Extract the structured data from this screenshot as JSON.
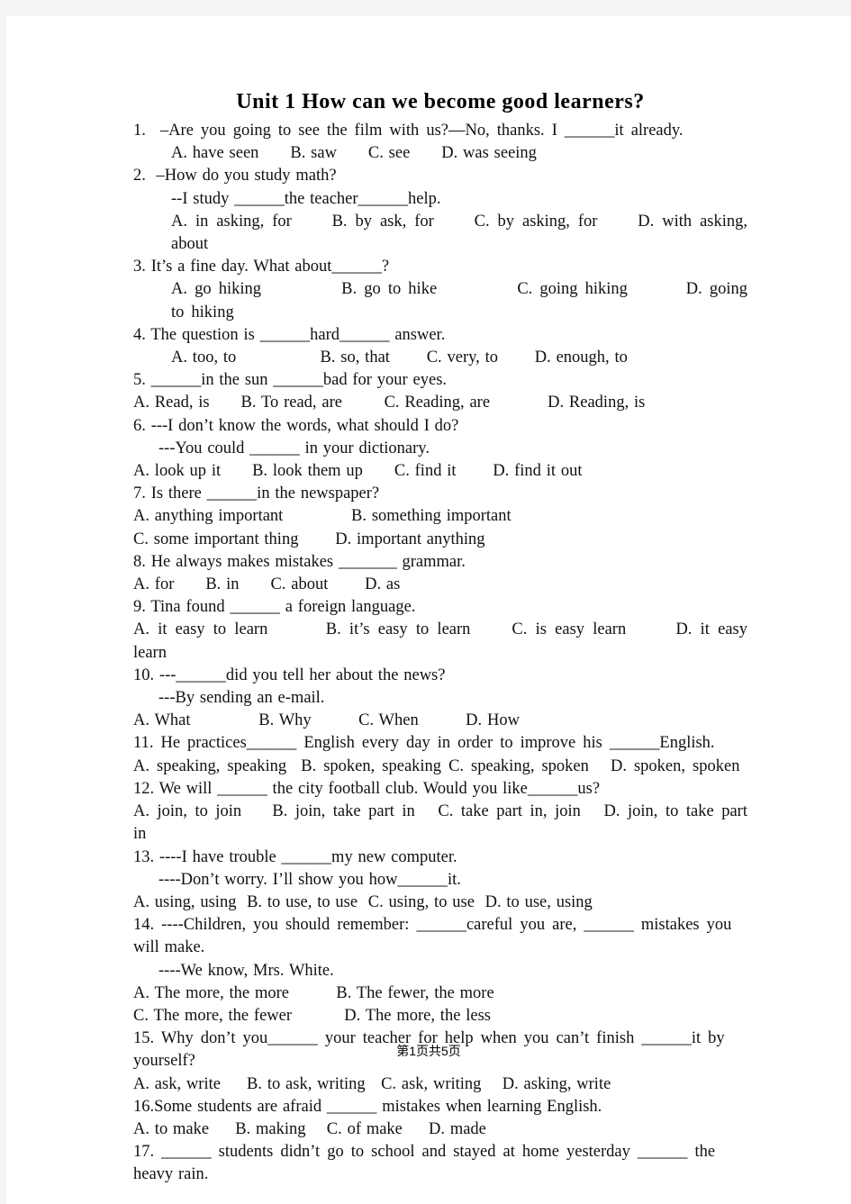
{
  "document": {
    "title": "Unit 1 How can we become good learners?",
    "footer": "第1页共5页",
    "page_background": "#ffffff",
    "canvas_background": "#f4f4f4",
    "text_color": "#111111"
  },
  "lines": [
    {
      "text": "1.  –Are you going to see the film with us?—No, thanks. I ______it already.",
      "indent": 0,
      "wide": true
    },
    {
      "text": "A. have seen      B. saw      C. see      D. was seeing",
      "indent": 3,
      "wide": false
    },
    {
      "text": "2.  –How do you study math?",
      "indent": 0,
      "wide": false
    },
    {
      "text": "--I study ______the teacher______help.",
      "indent": 3,
      "wide": false
    },
    {
      "text": "A. in asking, for     B. by ask, for     C. by asking, for     D. with asking, about",
      "indent": 3,
      "wide": true
    },
    {
      "text": "3. It’s a fine day. What about______?",
      "indent": 0,
      "wide": false
    },
    {
      "text": "A. go hiking           B. go to hike           C. going hiking        D. going to hiking",
      "indent": 3,
      "wide": true
    },
    {
      "text": "4. The question is ______hard______ answer.",
      "indent": 0,
      "wide": false
    },
    {
      "text": "A. too, to                B. so, that       C. very, to       D. enough, to",
      "indent": 3,
      "wide": false
    },
    {
      "text": "5. ______in the sun ______bad for your eyes.",
      "indent": 0,
      "wide": false
    },
    {
      "text": "A. Read, is      B. To read, are        C. Reading, are           D. Reading, is",
      "indent": 0,
      "wide": false
    },
    {
      "text": "6. ---I don’t know the words, what should I do?",
      "indent": 0,
      "wide": false
    },
    {
      "text": "---You could ______ in your dictionary.",
      "indent": 2,
      "wide": false
    },
    {
      "text": "A. look up it      B. look them up      C. find it       D. find it out",
      "indent": 0,
      "wide": false
    },
    {
      "text": "7. Is there ______in the newspaper?",
      "indent": 0,
      "wide": false
    },
    {
      "text": "A. anything important             B. something important",
      "indent": 0,
      "wide": false
    },
    {
      "text": "C. some important thing       D. important anything",
      "indent": 0,
      "wide": false
    },
    {
      "text": "8. He always makes mistakes _______ grammar.",
      "indent": 0,
      "wide": false
    },
    {
      "text": "A. for      B. in      C. about       D. as",
      "indent": 0,
      "wide": false
    },
    {
      "text": "9. Tina found ______ a foreign language.",
      "indent": 0,
      "wide": false
    },
    {
      "text": "A. it easy to learn       B. it’s easy to learn     C. is easy learn      D. it easy learn",
      "indent": 0,
      "wide": true
    },
    {
      "text": "10. ---______did you tell her about the news?",
      "indent": 0,
      "wide": false
    },
    {
      "text": "---By sending an e-mail.",
      "indent": 2,
      "wide": false
    },
    {
      "text": "A. What             B. Why         C. When         D. How",
      "indent": 0,
      "wide": false
    },
    {
      "text": "11. He practices______ English every day in order to improve his ______English.",
      "indent": 0,
      "wide": true
    },
    {
      "text": "A. speaking, speaking  B. spoken, speaking C. speaking, spoken   D. spoken, spoken",
      "indent": 0,
      "wide": true
    },
    {
      "text": "12. We will ______ the city football club. Would you like______us?",
      "indent": 0,
      "wide": false
    },
    {
      "text": "A. join, to join    B. join, take part in   C. take part in, join   D. join, to take part in",
      "indent": 0,
      "wide": true
    },
    {
      "text": "13. ----I have trouble ______my new computer.",
      "indent": 0,
      "wide": false
    },
    {
      "text": "----Don’t worry. I’ll show you how______it.",
      "indent": 2,
      "wide": false
    },
    {
      "text": "A. using, using  B. to use, to use  C. using, to use  D. to use, using",
      "indent": 0,
      "wide": false
    },
    {
      "text": "14. ----Children, you should remember: ______careful you are, ______ mistakes you",
      "indent": 0,
      "wide": true
    },
    {
      "text": "will make.",
      "indent": 0,
      "wide": false
    },
    {
      "text": "----We know, Mrs. White.",
      "indent": 2,
      "wide": false
    },
    {
      "text": "A. The more, the more         B. The fewer, the more",
      "indent": 0,
      "wide": false
    },
    {
      "text": "C. The more, the fewer          D. The more, the less",
      "indent": 0,
      "wide": false
    },
    {
      "text": "15. Why don’t you______ your teacher for help when you can’t finish ______it by",
      "indent": 0,
      "wide": true
    },
    {
      "text": "yourself?",
      "indent": 0,
      "wide": false
    },
    {
      "text": "A. ask, write     B. to ask, writing   C. ask, writing    D. asking, write",
      "indent": 0,
      "wide": false
    },
    {
      "text": "16.Some students are afraid ______ mistakes when learning English.",
      "indent": 0,
      "wide": false
    },
    {
      "text": "A. to make     B. making    C. of make     D. made",
      "indent": 0,
      "wide": false
    },
    {
      "text": "17. ______ students didn’t go to school and stayed at home yesterday ______ the",
      "indent": 0,
      "wide": true
    },
    {
      "text": "heavy rain.",
      "indent": 0,
      "wide": false
    }
  ]
}
